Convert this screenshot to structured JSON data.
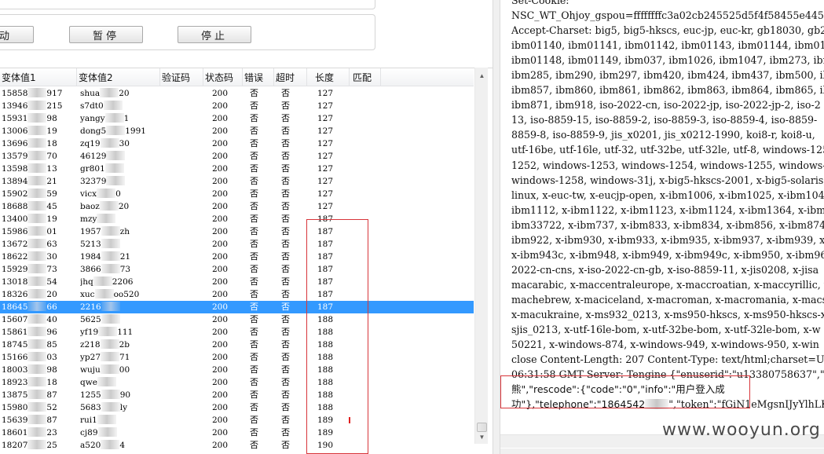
{
  "toolbar": {
    "start_label": "动",
    "pause_label": "暂停",
    "stop_label": "停止"
  },
  "table": {
    "headers": [
      "变体值1",
      "变体值2",
      "验证码",
      "状态码",
      "错误",
      "超时",
      "长度",
      "匹配"
    ],
    "selected_index": 17,
    "rows": [
      {
        "v1a": "15858",
        "v1b": "917",
        "v2a": "shua",
        "v2b": "20",
        "code": "",
        "status": "200",
        "err": "否",
        "timeout": "否",
        "len": "127",
        "match": ""
      },
      {
        "v1a": "13946",
        "v1b": "215",
        "v2a": "s7dt0",
        "v2b": "",
        "code": "",
        "status": "200",
        "err": "否",
        "timeout": "否",
        "len": "127",
        "match": ""
      },
      {
        "v1a": "15931",
        "v1b": "98",
        "v2a": "yangy",
        "v2b": "1",
        "code": "",
        "status": "200",
        "err": "否",
        "timeout": "否",
        "len": "127",
        "match": ""
      },
      {
        "v1a": "13006",
        "v1b": "19",
        "v2a": "dong5",
        "v2b": "1991",
        "code": "",
        "status": "200",
        "err": "否",
        "timeout": "否",
        "len": "127",
        "match": ""
      },
      {
        "v1a": "13696",
        "v1b": "18",
        "v2a": "zq19",
        "v2b": "30",
        "code": "",
        "status": "200",
        "err": "否",
        "timeout": "否",
        "len": "127",
        "match": ""
      },
      {
        "v1a": "13579",
        "v1b": "70",
        "v2a": "46129",
        "v2b": "",
        "code": "",
        "status": "200",
        "err": "否",
        "timeout": "否",
        "len": "127",
        "match": ""
      },
      {
        "v1a": "13598",
        "v1b": "13",
        "v2a": "gr801",
        "v2b": "",
        "code": "",
        "status": "200",
        "err": "否",
        "timeout": "否",
        "len": "127",
        "match": ""
      },
      {
        "v1a": "13894",
        "v1b": "21",
        "v2a": "32379",
        "v2b": "",
        "code": "",
        "status": "200",
        "err": "否",
        "timeout": "否",
        "len": "127",
        "match": ""
      },
      {
        "v1a": "15902",
        "v1b": "59",
        "v2a": "vicx",
        "v2b": "0",
        "code": "",
        "status": "200",
        "err": "否",
        "timeout": "否",
        "len": "127",
        "match": ""
      },
      {
        "v1a": "18688",
        "v1b": "45",
        "v2a": "baoz",
        "v2b": "20",
        "code": "",
        "status": "200",
        "err": "否",
        "timeout": "否",
        "len": "127",
        "match": ""
      },
      {
        "v1a": "13400",
        "v1b": "19",
        "v2a": "mzy",
        "v2b": "",
        "code": "",
        "status": "200",
        "err": "否",
        "timeout": "否",
        "len": "187",
        "match": ""
      },
      {
        "v1a": "15986",
        "v1b": "01",
        "v2a": "1957",
        "v2b": "zh",
        "code": "",
        "status": "200",
        "err": "否",
        "timeout": "否",
        "len": "187",
        "match": ""
      },
      {
        "v1a": "13672",
        "v1b": "63",
        "v2a": "5213",
        "v2b": "",
        "code": "",
        "status": "200",
        "err": "否",
        "timeout": "否",
        "len": "187",
        "match": ""
      },
      {
        "v1a": "18622",
        "v1b": "30",
        "v2a": "1984",
        "v2b": "21",
        "code": "",
        "status": "200",
        "err": "否",
        "timeout": "否",
        "len": "187",
        "match": ""
      },
      {
        "v1a": "15929",
        "v1b": "73",
        "v2a": "3866",
        "v2b": "73",
        "code": "",
        "status": "200",
        "err": "否",
        "timeout": "否",
        "len": "187",
        "match": ""
      },
      {
        "v1a": "13018",
        "v1b": "54",
        "v2a": "jhq",
        "v2b": "2206",
        "code": "",
        "status": "200",
        "err": "否",
        "timeout": "否",
        "len": "187",
        "match": ""
      },
      {
        "v1a": "18326",
        "v1b": "20",
        "v2a": "xuc",
        "v2b": "oo520",
        "code": "",
        "status": "200",
        "err": "否",
        "timeout": "否",
        "len": "187",
        "match": ""
      },
      {
        "v1a": "18645",
        "v1b": "66",
        "v2a": "2216",
        "v2b": "",
        "code": "",
        "status": "200",
        "err": "否",
        "timeout": "否",
        "len": "187",
        "match": ""
      },
      {
        "v1a": "15607",
        "v1b": "40",
        "v2a": "5625",
        "v2b": "",
        "code": "",
        "status": "200",
        "err": "否",
        "timeout": "否",
        "len": "188",
        "match": ""
      },
      {
        "v1a": "15861",
        "v1b": "96",
        "v2a": "yf19",
        "v2b": "111",
        "code": "",
        "status": "200",
        "err": "否",
        "timeout": "否",
        "len": "188",
        "match": ""
      },
      {
        "v1a": "18745",
        "v1b": "85",
        "v2a": "z218",
        "v2b": "2b",
        "code": "",
        "status": "200",
        "err": "否",
        "timeout": "否",
        "len": "188",
        "match": ""
      },
      {
        "v1a": "15166",
        "v1b": "03",
        "v2a": "yp27",
        "v2b": "71",
        "code": "",
        "status": "200",
        "err": "否",
        "timeout": "否",
        "len": "188",
        "match": ""
      },
      {
        "v1a": "18003",
        "v1b": "98",
        "v2a": "wuju",
        "v2b": "00",
        "code": "",
        "status": "200",
        "err": "否",
        "timeout": "否",
        "len": "188",
        "match": ""
      },
      {
        "v1a": "18923",
        "v1b": "18",
        "v2a": "qwe",
        "v2b": "",
        "code": "",
        "status": "200",
        "err": "否",
        "timeout": "否",
        "len": "188",
        "match": ""
      },
      {
        "v1a": "13875",
        "v1b": "87",
        "v2a": "1255",
        "v2b": "90",
        "code": "",
        "status": "200",
        "err": "否",
        "timeout": "否",
        "len": "188",
        "match": ""
      },
      {
        "v1a": "15980",
        "v1b": "52",
        "v2a": "5683",
        "v2b": "ly",
        "code": "",
        "status": "200",
        "err": "否",
        "timeout": "否",
        "len": "188",
        "match": ""
      },
      {
        "v1a": "15639",
        "v1b": "87",
        "v2a": "rui1",
        "v2b": "",
        "code": "",
        "status": "200",
        "err": "否",
        "timeout": "否",
        "len": "189",
        "match": ""
      },
      {
        "v1a": "18601",
        "v1b": "23",
        "v2a": "cj89",
        "v2b": "",
        "code": "",
        "status": "200",
        "err": "否",
        "timeout": "否",
        "len": "189",
        "match": ""
      },
      {
        "v1a": "18207",
        "v1b": "25",
        "v2a": "a520",
        "v2b": "4",
        "code": "",
        "status": "200",
        "err": "否",
        "timeout": "否",
        "len": "190",
        "match": ""
      }
    ]
  },
  "response": {
    "lines": [
      "Set-Cookie:",
      "NSC_WT_Ohjoy_gspou=ffffffffc3a02cb245525d5f4f58455e445",
      "Accept-Charset: big5, big5-hkscs, euc-jp, euc-kr, gb18030, gb23",
      "ibm01140, ibm01141, ibm01142, ibm01143, ibm01144, ibm011",
      "ibm01148, ibm01149, ibm037, ibm1026, ibm1047, ibm273, ibm2",
      "ibm285, ibm290, ibm297, ibm420, ibm424, ibm437, ibm500, ibm",
      "ibm857, ibm860, ibm861, ibm862, ibm863, ibm864, ibm865, ibm",
      "ibm871, ibm918, iso-2022-cn, iso-2022-jp, iso-2022-jp-2, iso-2",
      "13, iso-8859-15, iso-8859-2, iso-8859-3, iso-8859-4, iso-8859-",
      "8859-8, iso-8859-9, jis_x0201, jis_x0212-1990, koi8-r, koi8-u,",
      "utf-16be, utf-16le, utf-32, utf-32be, utf-32le, utf-8, windows-125",
      "1252, windows-1253, windows-1254, windows-1255, windows-",
      "windows-1258, windows-31j, x-big5-hkscs-2001, x-big5-solaris,",
      "linux, x-euc-tw, x-eucjp-open, x-ibm1006, x-ibm1025, x-ibm104",
      "ibm1112, x-ibm1122, x-ibm1123, x-ibm1124, x-ibm1364, x-ibm",
      "ibm33722, x-ibm737, x-ibm833, x-ibm834, x-ibm856, x-ibm874",
      "ibm922, x-ibm930, x-ibm933, x-ibm935, x-ibm937, x-ibm939, x-",
      "x-ibm943c, x-ibm948, x-ibm949, x-ibm949c, x-ibm950, x-ibm96",
      "2022-cn-cns, x-iso-2022-cn-gb, x-iso-8859-11, x-jis0208, x-jisa",
      "macarabic, x-maccentraleurope, x-maccroatian, x-maccyrillic, x-m",
      "machebrew, x-maciceland, x-macroman, x-macromania, x-macsym",
      "x-macukraine, x-ms932_0213, x-ms950-hkscs, x-ms950-hkscs-x",
      "sjis_0213, x-utf-16le-bom, x-utf-32be-bom, x-utf-32le-bom, x-w",
      "50221, x-windows-874, x-windows-949, x-windows-950, x-win",
      "close Content-Length: 207 Content-Type: text/html;charset=UTF-",
      "06:31:58 GMT Server: Tengine {\"enuserid\":\"u13380758637\",\"erro"
    ],
    "highlight_line1": "熊\",\"rescode\":{\"code\":\"0\",\"info\":\"用户登入成",
    "highlight_line2_a": "功\"},\"telephone\":\"1864542",
    "highlight_line2_b": "\",\"token\":\"fGiN1eMgsnIJyYlhLK"
  },
  "watermark": "www.wooyun.org"
}
